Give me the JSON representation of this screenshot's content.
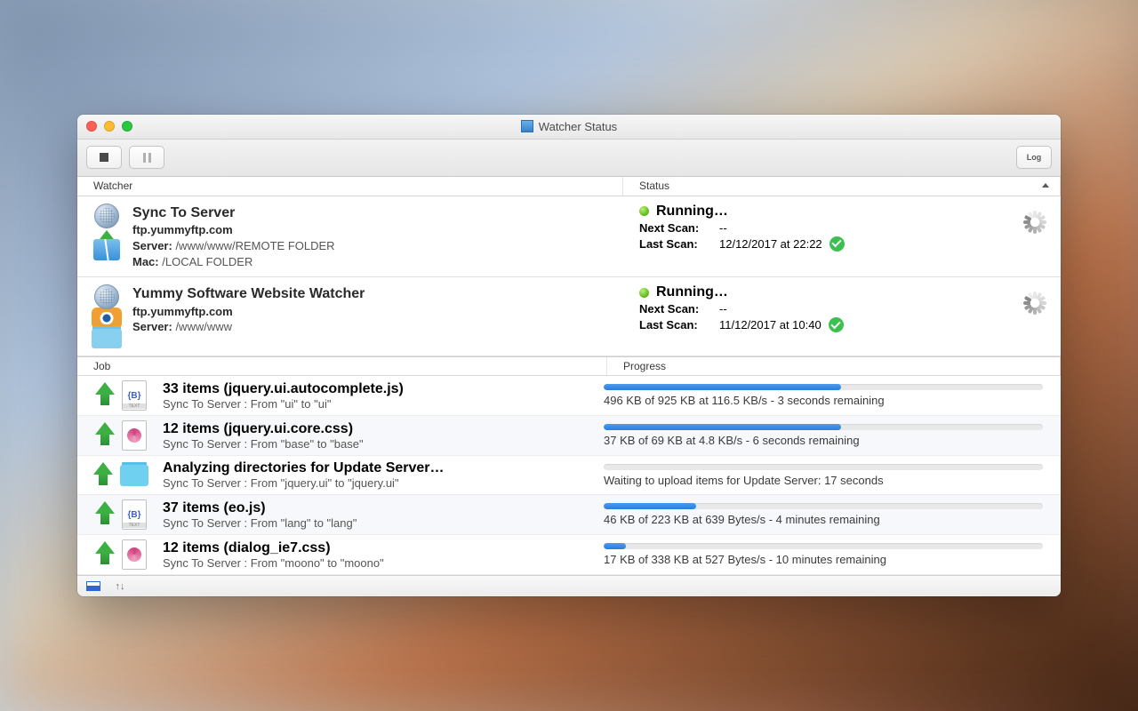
{
  "window": {
    "title": "Watcher Status"
  },
  "columns": {
    "watcher": "Watcher",
    "status": "Status",
    "job": "Job",
    "progress": "Progress"
  },
  "labels": {
    "server": "Server:",
    "mac": "Mac:",
    "next_scan": "Next Scan:",
    "last_scan": "Last Scan:"
  },
  "watchers": [
    {
      "name": "Sync To Server",
      "host": "ftp.yummyftp.com",
      "server_path": "/www/www/REMOTE FOLDER",
      "mac_path": "/LOCAL FOLDER",
      "status": "Running…",
      "next_scan": "--",
      "last_scan": "12/12/2017 at 22:22",
      "kind": "sync"
    },
    {
      "name": "Yummy Software Website Watcher",
      "host": "ftp.yummyftp.com",
      "server_path": "/www/www",
      "mac_path": "",
      "status": "Running…",
      "next_scan": "--",
      "last_scan": "11/12/2017 at 10:40",
      "kind": "watch"
    }
  ],
  "jobs": [
    {
      "title": "33 items (jquery.ui.autocomplete.js)",
      "sub": "Sync To Server : From \"ui\" to \"ui\"",
      "progress_pct": 54,
      "progress_text": "496 KB of 925 KB at 116.5 KB/s - 3 seconds remaining",
      "icon": "text"
    },
    {
      "title": "12 items (jquery.ui.core.css)",
      "sub": "Sync To Server : From \"base\" to \"base\"",
      "progress_pct": 54,
      "progress_text": "37 KB of 69 KB at 4.8 KB/s - 6 seconds remaining",
      "icon": "css"
    },
    {
      "title": "Analyzing directories for Update Server…",
      "sub": "Sync To Server : From \"jquery.ui\" to \"jquery.ui\"",
      "progress_pct": 0,
      "progress_text": "Waiting to upload items for Update Server: 17 seconds",
      "icon": "folder"
    },
    {
      "title": "37 items (eo.js)",
      "sub": "Sync To Server : From \"lang\" to \"lang\"",
      "progress_pct": 21,
      "progress_text": "46 KB of 223 KB at 639 Bytes/s - 4 minutes remaining",
      "icon": "text"
    },
    {
      "title": "12 items (dialog_ie7.css)",
      "sub": "Sync To Server : From \"moono\" to \"moono\"",
      "progress_pct": 5,
      "progress_text": "17 KB of 338 KB at 527 Bytes/s - 10 minutes remaining",
      "icon": "css"
    }
  ]
}
